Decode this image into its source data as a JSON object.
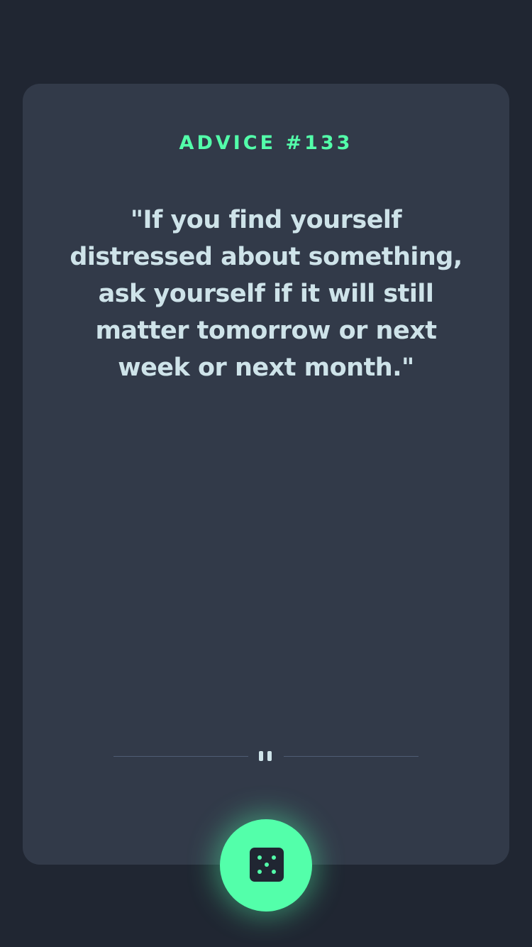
{
  "advice": {
    "title": "ADVICE #133",
    "quote": "\"If you find yourself distressed about something, ask yourself if it will still matter tomorrow or next week or next month.\""
  },
  "colors": {
    "background": "#202632",
    "card": "#323a49",
    "accent": "#53ffaa",
    "text": "#cee3e9",
    "divider": "#4f5d74"
  },
  "icons": {
    "divider": "pause-icon",
    "button": "dice-icon"
  }
}
